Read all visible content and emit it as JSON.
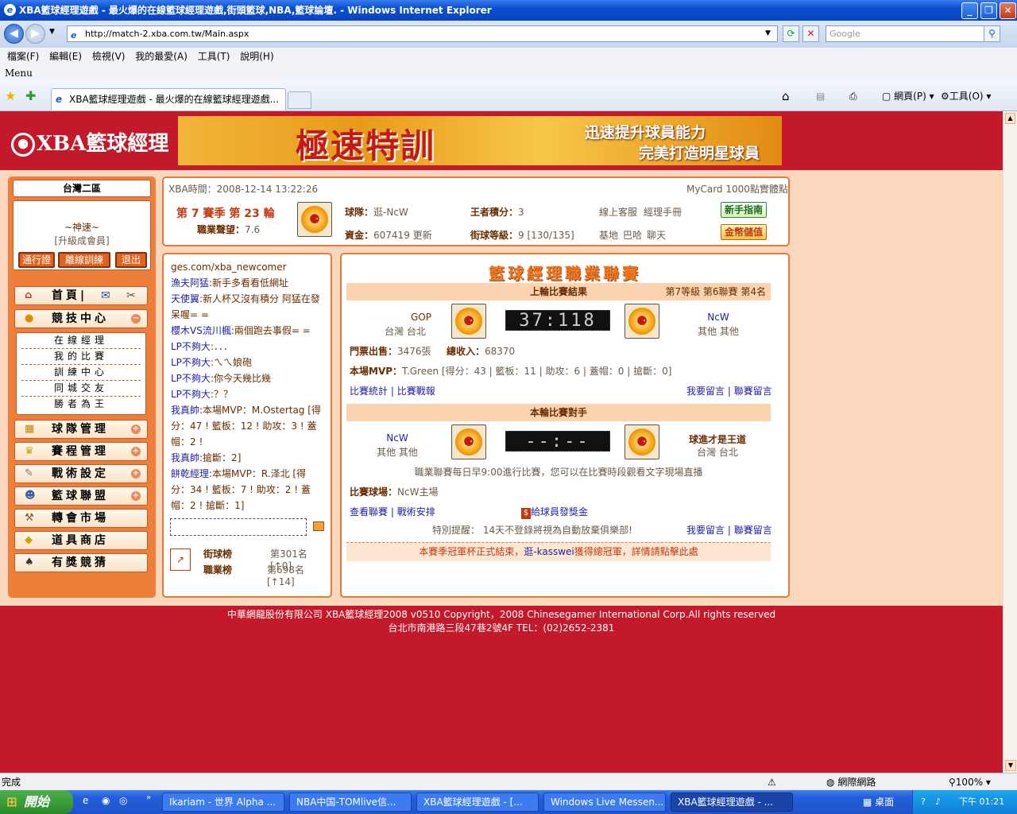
{
  "window": {
    "title": "XBA籃球經理遊戲 - 最火爆的在線籃球經理遊戲,街頭籃球,NBA,籃球論壇. - Windows Internet Explorer",
    "minimize_label": "_",
    "maximize_label": "❐",
    "close_label": "✕"
  },
  "browser": {
    "back_icon": "◀",
    "forward_icon": "▶",
    "address": "http://match-2.xba.com.tw/Main.aspx",
    "search_placeholder": "Google",
    "menu": [
      "檔案(F)",
      "編輯(E)",
      "檢視(V)",
      "我的最愛(A)",
      "工具(T)",
      "說明(H)"
    ],
    "menu_label": "Menu",
    "tab_title": "XBA籃球經理遊戲 - 最火爆的在線籃球經理遊戲...",
    "toolbar": {
      "page": "網頁(P)",
      "tools": "工具(O)"
    }
  },
  "header": {
    "logo_text": "XBA籃球經理",
    "banner_title": "極速特訓",
    "banner_line1": "迅速提升球員能力",
    "banner_line2": "完美打造明星球員"
  },
  "left": {
    "region": "台灣二區",
    "username": "~神速~",
    "member": "[升級成會員]",
    "buttons": [
      "通行證",
      "離線訓練",
      "退出"
    ],
    "nav_home": "首頁",
    "nav": [
      "競技中心",
      "球隊管理",
      "賽程管理",
      "戰術設定",
      "籃球聯盟",
      "轉會市場",
      "道具商店",
      "有獎競猜"
    ],
    "subnav": [
      "在線經理",
      "我的比賽",
      "訓練中心",
      "同城交友",
      "勝者為王"
    ]
  },
  "info": {
    "time_label": "XBA時間：2008-12-14 13:22:26",
    "mycard": "MyCard 1000點實體點",
    "season": "第 7 賽季 第 23 輪",
    "career_label": "職業聲望：",
    "career_value": "7.6",
    "team_label": "球隊：",
    "team_value": "逛-NcW",
    "king_label": "王者積分：",
    "king_value": "3",
    "online": "線上客服",
    "manual": "經理手冊",
    "guide_btn": "新手指南",
    "funds_label": "資金：",
    "funds_value": "607419",
    "update": "更新",
    "level_label": "街球等級：",
    "level_value": "9 [130/135]",
    "base": "基地",
    "bar": "巴哈",
    "chat": "聊天",
    "gold_btn": "金幣儲值"
  },
  "chat": {
    "lines": [
      {
        "n": "",
        "m": "ges.com/xba_newcomer"
      },
      {
        "n": "漁夫阿猛",
        "m": ":新手多看看低網址"
      },
      {
        "n": "天使翼",
        "m": ":新人杯又沒有積分  阿猛在發呆喔= ="
      },
      {
        "n": "櫻木VS流川楓",
        "m": ":兩個跑去事假= ="
      },
      {
        "n": "LP不夠大",
        "m": ":．．．"
      },
      {
        "n": "LP不夠大",
        "m": ":ㄟㄟ娘砲"
      },
      {
        "n": "LP不夠大",
        "m": ":你今天幾比幾"
      },
      {
        "n": "LP不夠大",
        "m": ":？？"
      },
      {
        "n": "我真帥",
        "m": ":本場MVP：M.Ostertag [得分：47 ! 籃板：12 ! 助攻：3 ! 蓋帽：2 !"
      },
      {
        "n": "我真帥",
        "m": ":搶斷：2]"
      },
      {
        "n": "餅乾經理",
        "m": ":本場MVP：R.泽北 [得分：34 ! 籃板：7 ! 助攻：2 ! 蓋帽：2 ! 搶斷：1]"
      }
    ],
    "rank1_label": "街球榜",
    "rank1_value": "第301名[↑0]",
    "rank2_label": "職業榜",
    "rank2_value": "第698名[↑14]"
  },
  "league": {
    "title": "籃球經理職業聯賽",
    "last_header": "上輪比賽結果",
    "last_rank": "第7等級 第6聯賽 第4名",
    "home_team": "GOP",
    "home_city": "台灣 台北",
    "score": "37:118",
    "away_team": "NcW",
    "away_city": "其他 其他",
    "ticket_label": "門票出售：",
    "ticket_value": "3476張",
    "income_label": "總收入：",
    "income_value": "68370",
    "mvp_label": "本場MVP：",
    "mvp_value": "T.Green [得分：43 | 籃板：11 | 助攻：6 | 蓋帽：0 | 搶斷：0]",
    "stats_link": "比賽統計",
    "report_link": "比賽戰報",
    "msg1": "我要留言",
    "msg2": "聯賽留言",
    "this_header": "本輪比賽對手",
    "t1": "NcW",
    "t1_city": "其他 其他",
    "score2": "--:--",
    "t2": "球進才是王道",
    "t2_city": "台灣 台北",
    "notice": "職業聯賽每日早9:00進行比賽，您可以在比賽時段觀看文字現場直播",
    "venue_label": "比賽球場：",
    "venue_value": "NcW主場",
    "view_league": "查看聯賽",
    "tactics": "戰術安排",
    "bonus": "給球員發獎金",
    "warn_label": "特別提醒：",
    "warn_value": "14天不登錄將視為自動放棄俱樂部!",
    "cup_prefix": "本賽季冠軍杯正式結束，",
    "cup_name": "逛-kasswei",
    "cup_suffix": "獲得總冠軍，詳情請點擊此處"
  },
  "footer": {
    "line1": "中華網龍股份有限公司  XBA籃球經理2008 v0510     Copyright，2008 Chinesegamer International Corp.All rights reserved",
    "line2": "台北市南港路三段47巷2號4F TEL：(02)2652-2381"
  },
  "status": {
    "text": "完成",
    "zone": "網際網路",
    "zoom": "100%"
  },
  "taskbar": {
    "start": "開始",
    "tasks": [
      "Ikariam - 世界 Alpha ...",
      "NBA中国-TOMlive信...",
      "XBA籃球經理遊戲 - [...",
      "Windows Live Messen...",
      "XBA籃球經理遊戲 - ..."
    ],
    "tray_label": "桌面",
    "clock": "下午 01:21"
  }
}
